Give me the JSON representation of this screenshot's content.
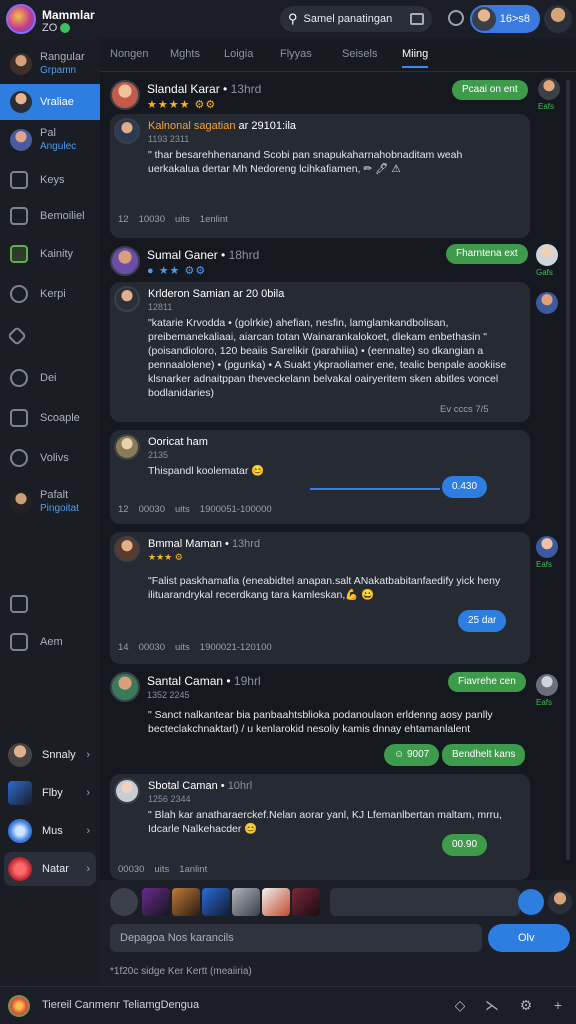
{
  "app": {
    "title": "Mammlar",
    "subtitle": "ZO"
  },
  "search": {
    "placeholder": "Samel panatingan"
  },
  "user": {
    "pill_label": "16>s8"
  },
  "sidebar": {
    "items": [
      {
        "label": "Rangular",
        "sub": "Grpamn",
        "name": "sidebar-item-rangular"
      },
      {
        "label": "Vraliae",
        "name": "sidebar-item-vraliae"
      },
      {
        "label": "Pal",
        "sub": "Angulec",
        "name": "sidebar-item-pal"
      },
      {
        "label": "Keys",
        "name": "sidebar-item-keys"
      },
      {
        "label": "Bemoiliel",
        "name": "sidebar-item-bemoiliel"
      },
      {
        "label": "Kainity",
        "name": "sidebar-item-kainity"
      },
      {
        "label": "Kerpi",
        "name": "sidebar-item-kerpi"
      },
      {
        "label": "Dei",
        "name": "sidebar-item-dei"
      },
      {
        "label": "Scoaple",
        "name": "sidebar-item-scoaple"
      },
      {
        "label": "Volivs",
        "name": "sidebar-item-volivs"
      },
      {
        "label": "Pafalt",
        "sub": "Pingoitat",
        "name": "sidebar-item-pafalt"
      },
      {
        "label": "Aem",
        "name": "sidebar-item-aem"
      }
    ],
    "bottom": [
      {
        "label": "Snnaly"
      },
      {
        "label": "Flby"
      },
      {
        "label": "Mus"
      },
      {
        "label": "Natar"
      }
    ]
  },
  "tabs": [
    "Nongen",
    "Mghts",
    "Loigia",
    "Flyyas",
    "Seisels",
    "Miing"
  ],
  "messages": [
    {
      "header_name": "Slandal Karar",
      "header_time": "13hrd",
      "author": "Kalnonal",
      "author_tag": "sagatian",
      "time_tag": "ar 29101:ila",
      "date": "1193 2311",
      "text": "\" thar besarehhenanand Scobi pan snapukaharnahobnaditam weah uerkakalua dertar Mh Nedoreng lcihkafiamen, ✏ 🖊 ⚠",
      "foot_count": "12",
      "foot_a": "10030",
      "foot_b": "uits",
      "foot_c": "1enlint",
      "right_pill": "Pcaai on ent",
      "right_label": "Eafs"
    },
    {
      "header_name": "Sumal Ganer",
      "header_time": "18hrd",
      "author": "Krlderon Samian",
      "time_tag": "ar 20 0bila",
      "date": "12811",
      "text": "\"katarie Krvodda • (golrkie) ahefian, nesfin, lamglamkandbolisan, preibemanekaliaai, aiarcan totan Wainarankalokoet, dlekam enbethasin \" (poisandioloro, 120 beaiis Sarelikir (parahiiia) • (eennalte) so dkangian a pennaalolene) • (pgunka) • A Suakt ykpraoliamer ene, tealic benpale aookiise klsnarker adnaitppan theveckelann belvakal oairyeritem sken abitles voncel bodlanidaries)",
      "foot_count": "",
      "foot_a": "",
      "foot_b": "",
      "foot_c": "Ev cccs 7/5",
      "right_pill": "Fharntena ext",
      "right_label": "Gafs"
    },
    {
      "header_name": "",
      "header_time": "",
      "author": "Ooricat ham",
      "time_tag": "",
      "date": "2135",
      "text": "Thispandl koolematar 😊",
      "foot_count": "12",
      "foot_a": "00030",
      "foot_b": "uits",
      "foot_c": "1900051-100000",
      "pill": "0.430"
    },
    {
      "header_name": "Bmmal Maman",
      "header_time": "13hrd",
      "author": "",
      "time_tag": "",
      "date": "",
      "text": "\"Falist paskhamafia (eneabidtel anapan.salt ANakatbabitanfaedify yick heny ilituarandrykal recerdkang tara kamleskan,💪 😀",
      "foot_count": "14",
      "foot_a": "00030",
      "foot_b": "uits",
      "foot_c": "1900021-120100",
      "pill": "25 dar",
      "right_label": "Eafs"
    },
    {
      "header_name": "Santal Caman",
      "header_time": "19hrl",
      "author": "",
      "time_tag": "",
      "date": "1352 2245",
      "text": "\" Sanct nalkantear bia panbaahtsblioka podanoulaon erldenng aosy panlly becteclakchnaktarl) / u kenlarokid nesoliy kamis dnnay ehtamanlalent",
      "foot_a": "9007",
      "right_pill": "Fiavrehe cen",
      "right_label": "Eafs",
      "emoji_pill": "Bendhelt kans"
    },
    {
      "header_name": "Sbotal Caman",
      "header_time": "10hrl",
      "author": "",
      "time_tag": "",
      "date": "1256 2344",
      "text": "\" Blah kar anatharaerckef.Nelan aorar yanl, KJ Lfemanlbertan maltam, mrru, Idcarle Nalkehacder 😊",
      "foot_a": "00030",
      "foot_b": "uits",
      "foot_c": "1anlint",
      "pill": "00.90"
    }
  ],
  "composer": {
    "placeholder": "Depagoa Nos karancils",
    "send_label": "Olv",
    "status": "*1f20c sidge Ker Kertt (meaiiria)"
  },
  "bottombar": {
    "label": "Tiereil Canmenr TeliamgDengua"
  }
}
